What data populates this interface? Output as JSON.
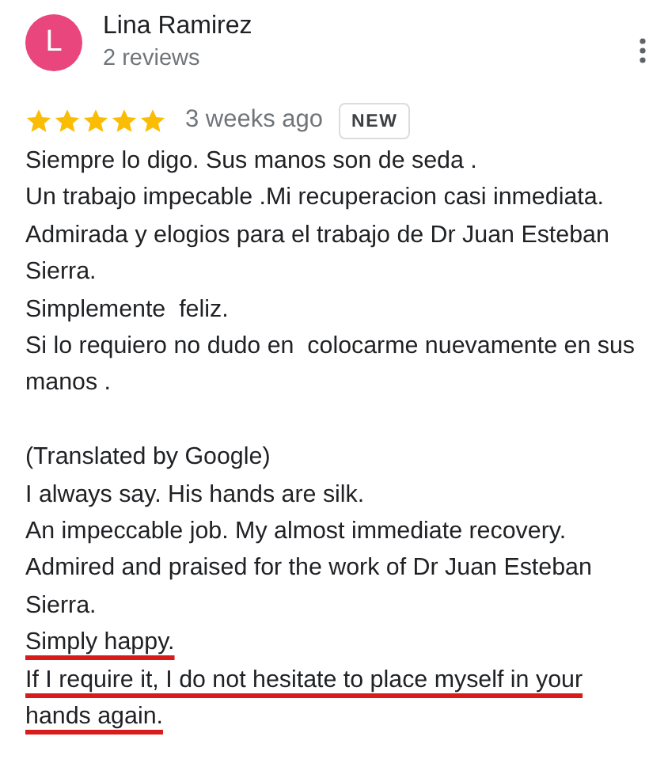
{
  "review": {
    "avatar_letter": "L",
    "author": "Lina Ramirez",
    "review_count": "2 reviews",
    "stars": 5,
    "time": "3 weeks ago",
    "badge": "NEW",
    "original_lines": [
      "Siempre lo digo. Sus manos son de seda .",
      "Un trabajo impecable .Mi recuperacion casi inmediata.",
      "Admirada y elogios para el trabajo de Dr Juan Esteban Sierra.",
      "Simplemente  feliz.",
      "Si lo requiero no dudo en  colocarme nuevamente en sus manos ."
    ],
    "translation_note": "(Translated by Google)",
    "translated_lines": [
      {
        "text": "I always say. His hands are silk.",
        "underlined": false
      },
      {
        "text": "An impeccable job. My almost immediate recovery.",
        "underlined": false
      },
      {
        "text": "Admired and praised for the work of Dr Juan Esteban Sierra.",
        "underlined": false
      },
      {
        "text": "Simply happy.",
        "underlined": true
      },
      {
        "text": "If I require it, I do not hesitate to place myself in your hands again. ",
        "underlined": true
      }
    ]
  }
}
